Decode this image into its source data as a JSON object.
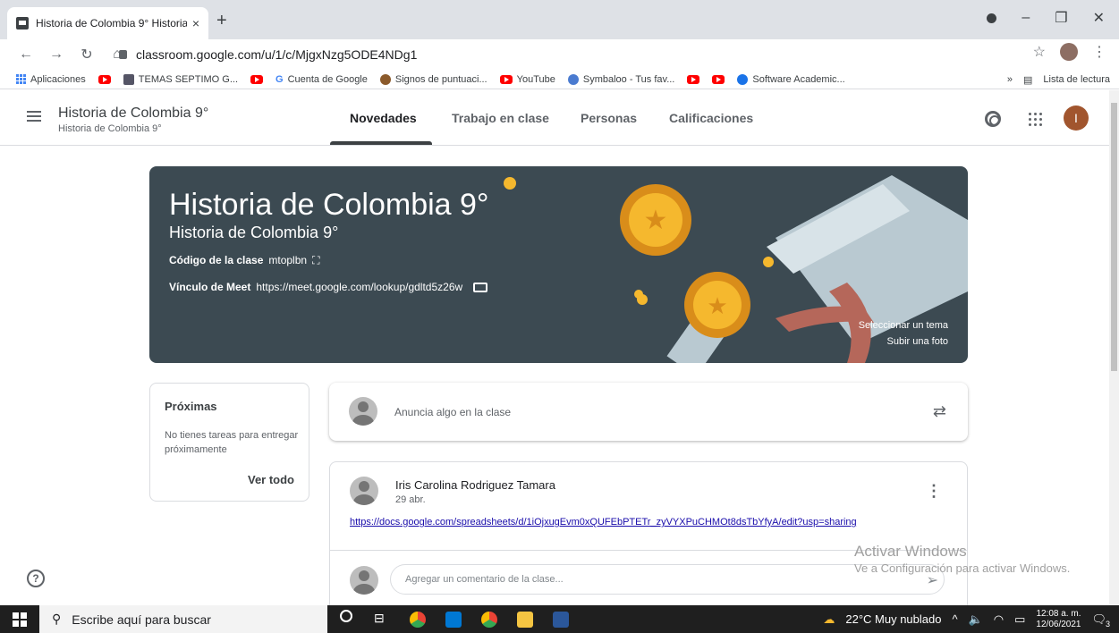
{
  "browser": {
    "tab_title": "Historia de Colombia 9° Historia",
    "tab_close": "×",
    "new_tab": "+",
    "address": "classroom.google.com/u/1/c/MjgxNzg5ODE4NDg1",
    "bookmarks": [
      "Aplicaciones",
      "TEMAS SEPTIMO G...",
      "Cuenta de Google",
      "Signos de puntuaci...",
      "YouTube",
      "Symbaloo - Tus fav...",
      "Software Academic..."
    ],
    "reading_list": "Lista de lectura",
    "more": "»"
  },
  "classroom": {
    "title": "Historia de Colombia 9°",
    "subtitle": "Historia de Colombia 9°",
    "avatar_letter": "I",
    "tabs": [
      {
        "label": "Novedades",
        "active": true
      },
      {
        "label": "Trabajo en clase",
        "active": false
      },
      {
        "label": "Personas",
        "active": false
      },
      {
        "label": "Calificaciones",
        "active": false
      }
    ]
  },
  "banner": {
    "title": "Historia de Colombia 9°",
    "subtitle": "Historia de Colombia 9°",
    "code_label": "Código de la clase",
    "code_value": "mtoplbn",
    "meet_label": "Vínculo de Meet",
    "meet_value": "https://meet.google.com/lookup/gdltd5z26w",
    "select_theme": "Seleccionar un tema",
    "upload_photo": "Subir una foto",
    "bg_color": "#3c4a52",
    "accent_gold": "#f5b82e"
  },
  "upcoming": {
    "title": "Próximas",
    "body": "No tienes tareas para entregar próximamente",
    "link": "Ver todo"
  },
  "announce": {
    "placeholder": "Anuncia algo en la clase"
  },
  "post": {
    "author": "Iris Carolina Rodriguez Tamara",
    "date": "29 abr.",
    "link": "https://docs.google.com/spreadsheets/d/1iOjxugEvm0xQUFEbPTETr_zyVYXPuCHMOt8dsTbYfyA/edit?usp=sharing",
    "comment_placeholder": "Agregar un comentario de la clase..."
  },
  "watermark": {
    "line1": "Activar Windows",
    "line2": "Ve a Configuración para activar Windows."
  },
  "taskbar": {
    "search": "Escribe aquí para buscar",
    "weather": "22°C  Muy nublado",
    "time": "12:08 a. m.",
    "date": "12/06/2021",
    "notif": "3"
  }
}
